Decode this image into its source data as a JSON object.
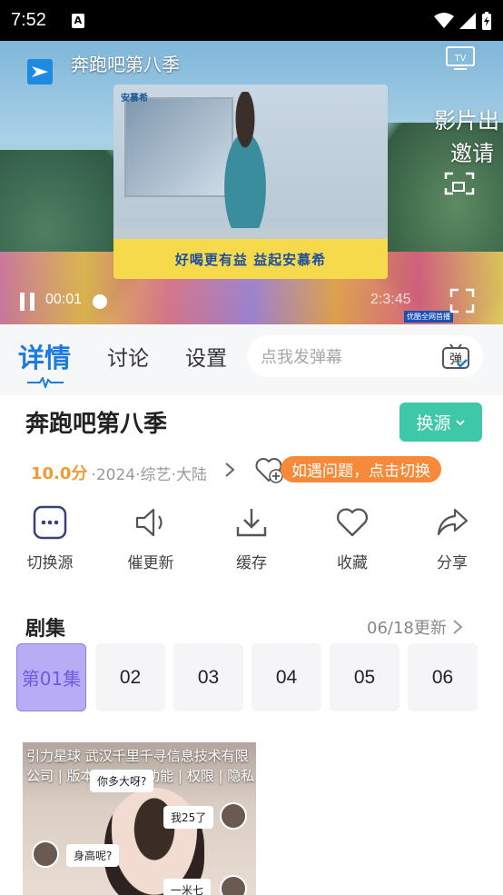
{
  "status_bar": {
    "time": "7:52",
    "notif_letter": "A"
  },
  "player": {
    "title": "奔跑吧第八季",
    "promo_line1": "影片出",
    "promo_line2": "邀请",
    "current_time": "00:01",
    "total_time": "2:3:45",
    "ad_brand": "安慕希",
    "ad_banner": "好喝更有益 益起安慕希",
    "youku_tag": "优酷全网首播",
    "progress_fraction": 0.0
  },
  "tabs": [
    {
      "label": "详情",
      "active": true
    },
    {
      "label": "讨论",
      "active": false
    },
    {
      "label": "设置",
      "active": false
    }
  ],
  "danmaku": {
    "placeholder": "点我发弹幕",
    "icon_label": "弹"
  },
  "show": {
    "title": "奔跑吧第八季",
    "source_button": "换源",
    "score": "10.0分",
    "meta": "·2024·综艺·大陆",
    "tip": "如遇问题，点击切换"
  },
  "actions": [
    {
      "label": "切换源",
      "icon": "more-dots-icon"
    },
    {
      "label": "催更新",
      "icon": "speaker-icon"
    },
    {
      "label": "缓存",
      "icon": "download-icon"
    },
    {
      "label": "收藏",
      "icon": "heart-icon"
    },
    {
      "label": "分享",
      "icon": "share-icon"
    }
  ],
  "episodes": {
    "header": "剧集",
    "update": "06/18更新",
    "items": [
      "第01集",
      "02",
      "03",
      "04",
      "05",
      "06"
    ],
    "active_index": 0
  },
  "ad": {
    "text": "引力星球 武汉千里千寻信息技术有限公司 | 版本 1.5.6 | 功能 | 权限 | 隐私",
    "bubbles": [
      "你多大呀?",
      "我25了",
      "身高呢?",
      "一米七"
    ]
  },
  "colors": {
    "accent": "#1c7ae0",
    "source_button": "#3ec8a8",
    "tip": "#f78a3a",
    "score": "#f39a33",
    "episode_active": "#b8adf5"
  }
}
